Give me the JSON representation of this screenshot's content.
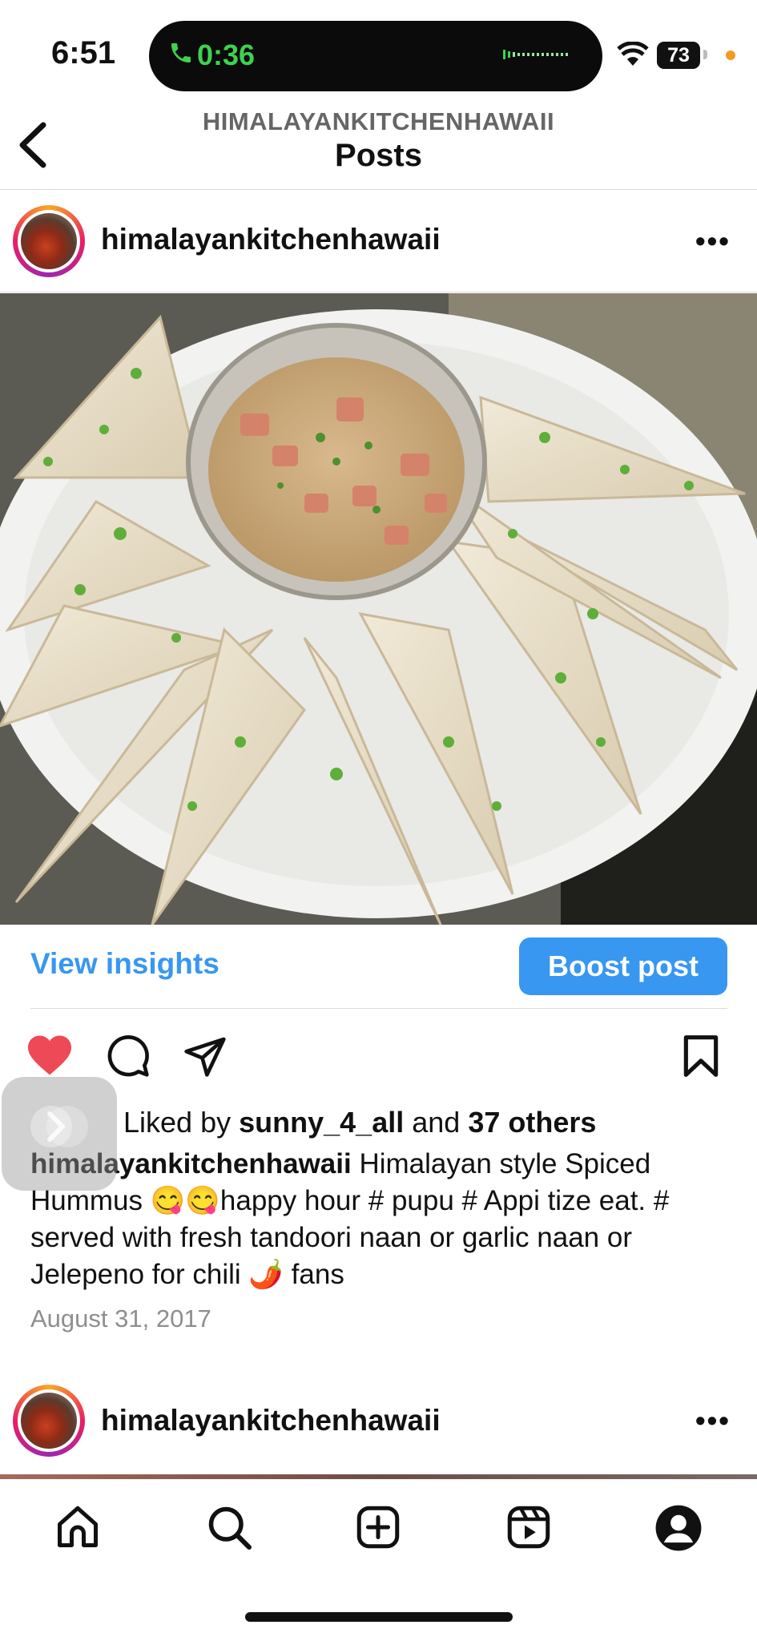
{
  "status_bar": {
    "time": "6:51",
    "call_timer": "0:36",
    "battery": "73",
    "call_color": "#3ed24f",
    "dot_color": "#f59a1e"
  },
  "header": {
    "username": "HIMALAYANKITCHENHAWAII",
    "title": "Posts"
  },
  "post": {
    "username": "himalayankitchenhawaii",
    "more": "•••",
    "view_insights": "View insights",
    "boost_label": "Boost post",
    "likes": {
      "prefix": "Liked by",
      "liker": "sunny_4_all",
      "conjunction": "and",
      "others": "37 others"
    },
    "caption": {
      "username": "himalayankitchenhawaii",
      "text": "Himalayan style Spiced  Hummus 😋😋happy hour # pupu # Appi tize eat. # served with fresh tandoori naan or garlic naan or Jelepeno for chili 🌶️ fans"
    },
    "date": "August 31, 2017",
    "liked": true
  },
  "next_post": {
    "username": "himalayankitchenhawaii",
    "more": "•••"
  },
  "colors": {
    "accent": "#3897f0",
    "heart": "#ed4956"
  },
  "bottom_nav": [
    "home-icon",
    "search-icon",
    "create-icon",
    "reels-icon",
    "profile-icon"
  ]
}
